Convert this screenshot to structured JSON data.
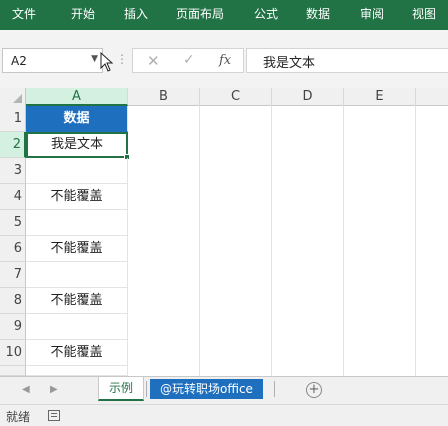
{
  "ribbon": {
    "tabs": [
      "文件",
      "开始",
      "插入",
      "页面布局",
      "公式",
      "数据",
      "审阅",
      "视图"
    ]
  },
  "formula_bar": {
    "name_box": "A2",
    "formula": "我是文本",
    "fx_label": "fx"
  },
  "grid": {
    "columns": [
      "A",
      "B",
      "C",
      "D",
      "E"
    ],
    "rows": [
      "1",
      "2",
      "3",
      "4",
      "5",
      "6",
      "7",
      "8",
      "9",
      "10"
    ],
    "selected_cell": "A2",
    "column_a_values": [
      "数据",
      "我是文本",
      "",
      "不能覆盖",
      "",
      "不能覆盖",
      "",
      "不能覆盖",
      "",
      "不能覆盖"
    ]
  },
  "sheets": {
    "tabs": [
      "示例",
      "@玩转职场office"
    ],
    "active": "示例",
    "add_label": "+"
  },
  "status": {
    "ready": "就绪"
  },
  "colors": {
    "ribbon": "#217346",
    "header_cell": "#1f6fbf",
    "selection": "#217346"
  }
}
